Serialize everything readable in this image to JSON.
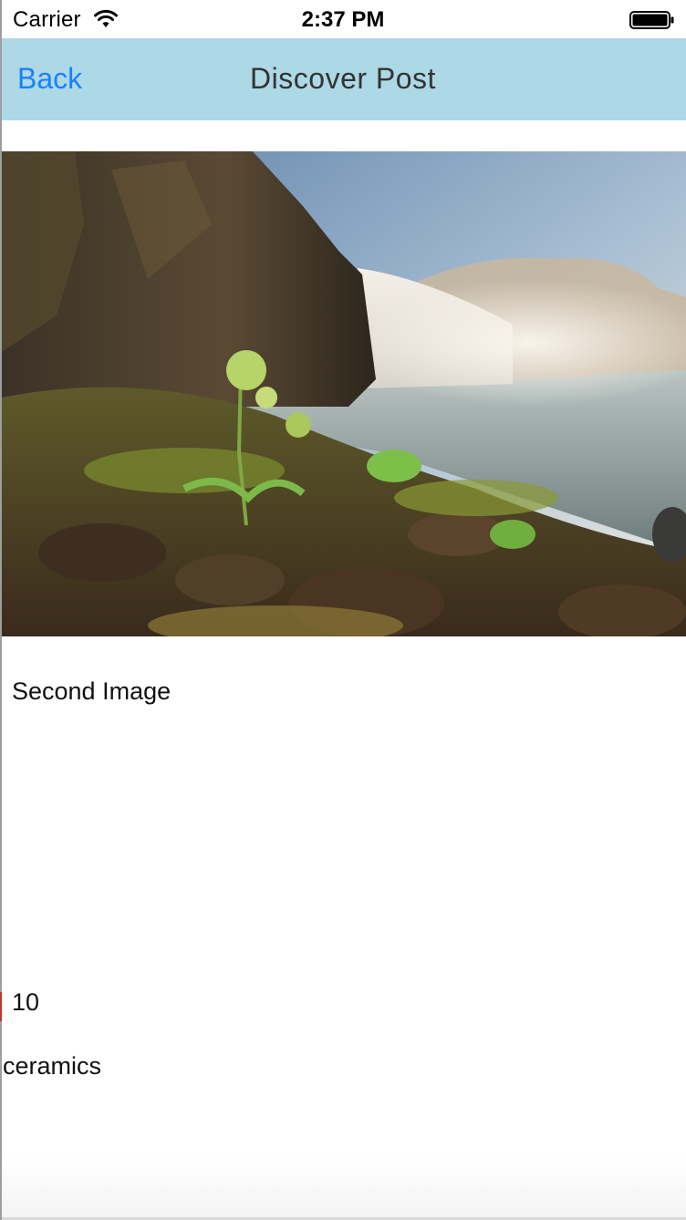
{
  "status_bar": {
    "carrier": "Carrier",
    "time": "2:37 PM",
    "wifi_icon": "wifi-icon",
    "battery_icon": "battery-icon"
  },
  "nav": {
    "back_label": "Back",
    "title": "Discover Post",
    "background": "#add8e6",
    "accent": "#1a82fb"
  },
  "post": {
    "image_subject": "waterfall-landscape-photo",
    "caption": "Second Image",
    "count": "10",
    "category": "ceramics"
  }
}
